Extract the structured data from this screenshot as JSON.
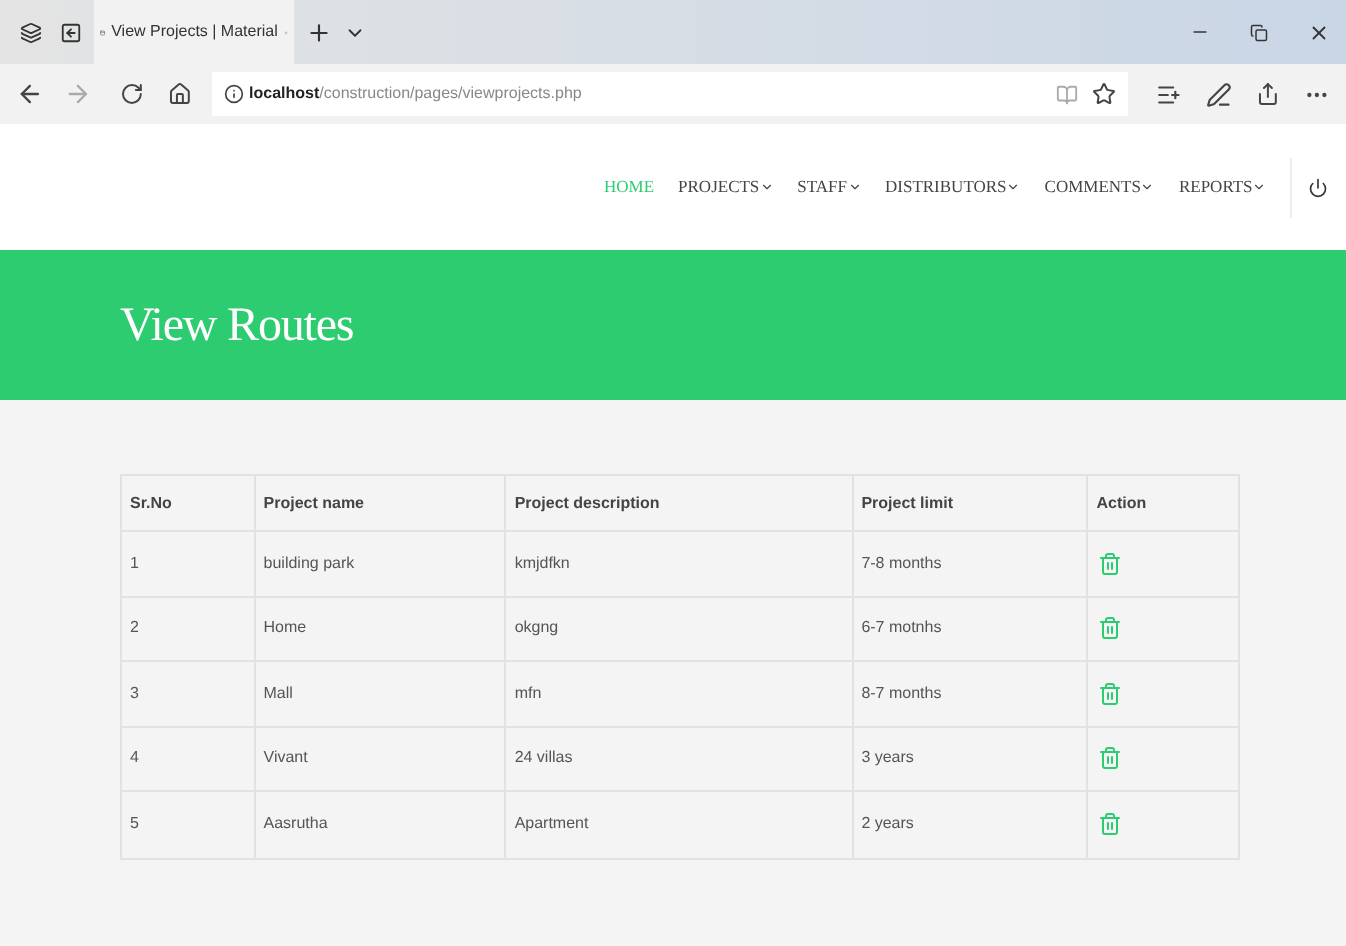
{
  "browser": {
    "tab_title": "View Projects | Material",
    "url_host": "localhost",
    "url_path": "/construction/pages/viewprojects.php"
  },
  "nav": [
    {
      "label": "HOME",
      "selected": true,
      "dropdown": false
    },
    {
      "label": "PROJECTS",
      "selected": false,
      "dropdown": true
    },
    {
      "label": "STAFF",
      "selected": false,
      "dropdown": true
    },
    {
      "label": "DISTRIBUTORS",
      "selected": false,
      "dropdown": true
    },
    {
      "label": "COMMENTS",
      "selected": false,
      "dropdown": true
    },
    {
      "label": "REPORTS",
      "selected": false,
      "dropdown": true
    }
  ],
  "banner": {
    "title": "View Routes"
  },
  "table": {
    "columns": [
      "Sr.No",
      "Project name",
      "Project description",
      "Project limit",
      "Action"
    ],
    "rows": [
      [
        "1",
        "building park",
        "kmjdfkn",
        "7-8 months"
      ],
      [
        "2",
        "Home",
        "okgng",
        "6-7 motnhs"
      ],
      [
        "3",
        "Mall",
        "mfn",
        "8-7 months"
      ],
      [
        "4",
        "Vivant",
        "24 villas",
        "3 years"
      ],
      [
        "5",
        "Aasrutha",
        "Apartment",
        "2 years"
      ]
    ]
  }
}
